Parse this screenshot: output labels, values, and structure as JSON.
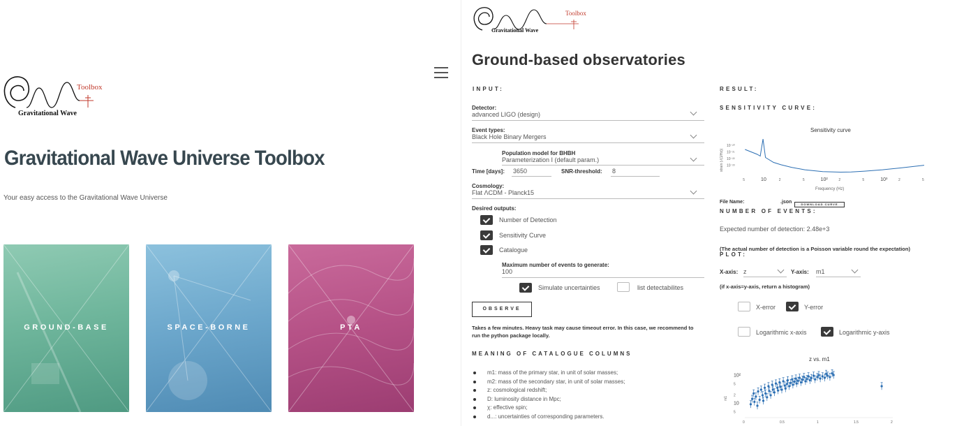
{
  "left": {
    "logo": {
      "word_top": "Toolbox",
      "word_bottom": "Gravitational Wave"
    },
    "title": "Gravitational Wave Universe Toolbox",
    "subtitle": "Your easy access to the Gravitational Wave Universe",
    "cards": [
      {
        "label": "GROUND-BASE",
        "color": "#6fb69c"
      },
      {
        "label": "SPACE-BORNE",
        "color": "#6ba6cb"
      },
      {
        "label": "PTA",
        "color": "#b55186"
      }
    ]
  },
  "right": {
    "logo": {
      "word_top": "Toolbox",
      "word_bottom": "Gravitational Wave"
    },
    "title": "Ground-based observatories",
    "input": {
      "heading": "INPUT:",
      "detector": {
        "label": "Detector:",
        "value": "advanced LIGO (design)"
      },
      "event_types": {
        "label": "Event types:",
        "value": "Black Hole Binary Mergers"
      },
      "population": {
        "label": "Population model for BHBH",
        "value": "Parameterization I (default param.)"
      },
      "time": {
        "label": "Time [days]:",
        "value": "3650"
      },
      "snr": {
        "label": "SNR-threshold:",
        "value": "8"
      },
      "cosmology": {
        "label": "Cosmology:",
        "value": "Flat ΛCDM - Planck15"
      },
      "desired_outputs": {
        "label": "Desired outputs:",
        "items": [
          {
            "label": "Number of Detection",
            "checked": true
          },
          {
            "label": "Sensitivity Curve",
            "checked": true
          },
          {
            "label": "Catalogue",
            "checked": true
          }
        ]
      },
      "max_events": {
        "label": "Maximum number of events to generate:",
        "value": "100"
      },
      "simulate_uncertainties": {
        "label": "Simulate uncertainties",
        "checked": true
      },
      "list_detectabilities": {
        "label": "list detectabilites",
        "checked": false
      },
      "observe_button": "OBSERVE",
      "note": "Takes a few minutes. Heavy task may cause timeout error. In this case, we recommend to run the python package locally.",
      "catalogue_heading": "MEANING OF CATALOGUE COLUMNS",
      "catalogue_items": [
        "m1: mass of the primary star, in unit of solar masses;",
        "m2: mass of the secondary star, in unit of solar masses;",
        "z: cosmological redshift;",
        "D: luminosity distance in Mpc;",
        "χ: effective spin;",
        "d...: uncertainties of corresponding parameters."
      ]
    },
    "result": {
      "heading": "RESULT:",
      "sensitivity_heading": "SENSITIVITY CURVE:",
      "file_name_label": "File Name:",
      "file_ext": ".json",
      "download_button": "DOWNLOAD CURVE",
      "events_heading": "NUMBER OF EVENTS:",
      "expected": "Expected number of detection: 2.48e+3",
      "poisson_note": "(The actual number of detection is a Poisson variable round the expectation)",
      "plot_heading": "PLOT:",
      "x_axis": {
        "label": "X-axis:",
        "value": "z"
      },
      "y_axis": {
        "label": "Y-axis:",
        "value": "m1"
      },
      "hist_note": "(if x-axis=y-axis, return a histogram)",
      "x_error": {
        "label": "X-error",
        "checked": false
      },
      "y_error": {
        "label": "Y-error",
        "checked": true
      },
      "log_x": {
        "label": "Logarithmic x-axis",
        "checked": false
      },
      "log_y": {
        "label": "Logarithmic y-axis",
        "checked": true
      }
    }
  },
  "chart_data": [
    {
      "type": "line",
      "title": "Sensitivity curve",
      "xlabel": "Frequency (Hz)",
      "ylabel": "strain (√(1/Hz))",
      "x_scale": "log",
      "y_scale": "log",
      "x_tick_labels": [
        "5",
        "10",
        "2",
        "5",
        "10²",
        "2",
        "5",
        "10³",
        "2",
        "5"
      ],
      "y_tick_labels": [
        "10⁻²⁰",
        "10⁻²¹",
        "10⁻²²",
        "10⁻²³"
      ],
      "series": [
        {
          "x": [
            5,
            8,
            9,
            10,
            11,
            15,
            20,
            30,
            50,
            100,
            200,
            300,
            500,
            1000,
            2000,
            5000
          ],
          "y": [
            2e-21,
            5e-22,
            3e-22,
            4e-20,
            2e-22,
            5e-23,
            2.5e-23,
            1.2e-23,
            6e-24,
            3.5e-24,
            3e-24,
            3.2e-24,
            4e-24,
            6e-24,
            1e-23,
            2.2e-23
          ]
        }
      ]
    },
    {
      "type": "scatter",
      "title": "z vs. m1",
      "xlabel": "",
      "ylabel": "m1",
      "x_tick_labels": [
        "0",
        "0.5",
        "1",
        "1.5",
        "2"
      ],
      "y_tick_labels": [
        "10²",
        "5",
        "2",
        "10",
        "5"
      ],
      "xlim": [
        0,
        2
      ],
      "y_scale": "log",
      "ylim": [
        3,
        150
      ],
      "points": [
        [
          0.08,
          9
        ],
        [
          0.1,
          14
        ],
        [
          0.12,
          22
        ],
        [
          0.13,
          11
        ],
        [
          0.15,
          17
        ],
        [
          0.17,
          8
        ],
        [
          0.18,
          26
        ],
        [
          0.2,
          13
        ],
        [
          0.22,
          30
        ],
        [
          0.24,
          19
        ],
        [
          0.25,
          12
        ],
        [
          0.27,
          35
        ],
        [
          0.28,
          22
        ],
        [
          0.3,
          16
        ],
        [
          0.32,
          40
        ],
        [
          0.33,
          27
        ],
        [
          0.35,
          19
        ],
        [
          0.37,
          45
        ],
        [
          0.38,
          30
        ],
        [
          0.4,
          24
        ],
        [
          0.42,
          50
        ],
        [
          0.44,
          35
        ],
        [
          0.45,
          28
        ],
        [
          0.47,
          55
        ],
        [
          0.48,
          38
        ],
        [
          0.5,
          30
        ],
        [
          0.52,
          60
        ],
        [
          0.54,
          42
        ],
        [
          0.55,
          33
        ],
        [
          0.57,
          48
        ],
        [
          0.58,
          65
        ],
        [
          0.6,
          40
        ],
        [
          0.62,
          52
        ],
        [
          0.64,
          70
        ],
        [
          0.65,
          45
        ],
        [
          0.67,
          58
        ],
        [
          0.69,
          75
        ],
        [
          0.7,
          50
        ],
        [
          0.72,
          62
        ],
        [
          0.74,
          80
        ],
        [
          0.76,
          55
        ],
        [
          0.78,
          68
        ],
        [
          0.8,
          85
        ],
        [
          0.82,
          60
        ],
        [
          0.84,
          72
        ],
        [
          0.86,
          90
        ],
        [
          0.88,
          65
        ],
        [
          0.9,
          78
        ],
        [
          0.93,
          95
        ],
        [
          0.95,
          70
        ],
        [
          0.98,
          85
        ],
        [
          1.0,
          100
        ],
        [
          1.02,
          75
        ],
        [
          1.05,
          90
        ],
        [
          1.08,
          80
        ],
        [
          1.1,
          110
        ],
        [
          1.12,
          95
        ],
        [
          1.15,
          85
        ],
        [
          1.18,
          115
        ],
        [
          1.2,
          100
        ],
        [
          1.85,
          40
        ]
      ]
    }
  ]
}
